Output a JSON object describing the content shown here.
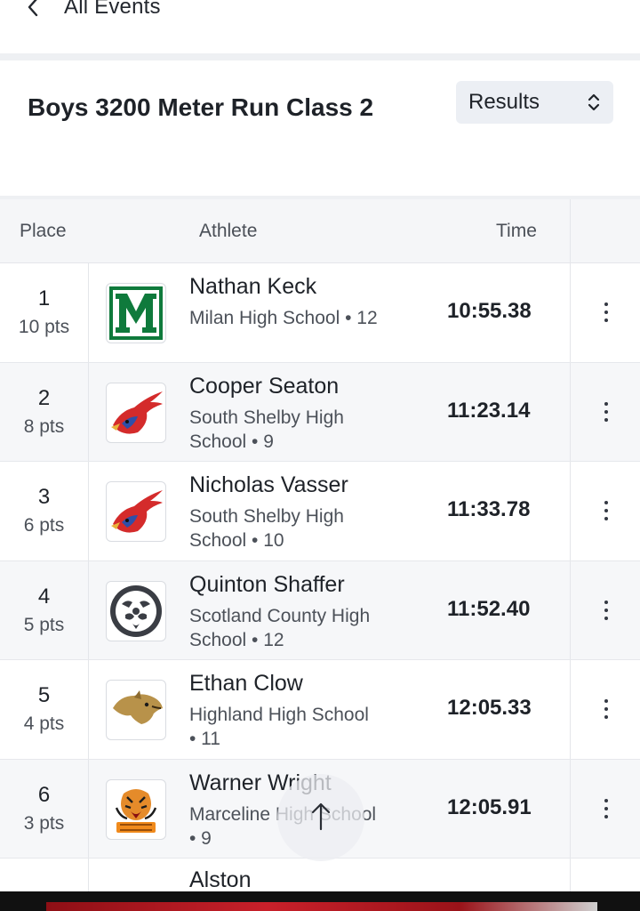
{
  "nav": {
    "back_label": "All Events"
  },
  "event": {
    "title": "Boys 3200 Meter Run Class 2"
  },
  "view_select": {
    "selected": "Results"
  },
  "table": {
    "headers": {
      "place": "Place",
      "athlete": "Athlete",
      "time": "Time"
    },
    "rows": [
      {
        "place": "1",
        "points": "10 pts",
        "name": "Nathan Keck",
        "school": "Milan High School • 12",
        "time": "10:55.38",
        "logo": "milan-m-logo"
      },
      {
        "place": "2",
        "points": "8 pts",
        "name": "Cooper Seaton",
        "school": "South Shelby High School • 9",
        "time": "11:23.14",
        "logo": "cardinal-logo"
      },
      {
        "place": "3",
        "points": "6 pts",
        "name": "Nicholas Vasser",
        "school": "South Shelby High School • 10",
        "time": "11:33.78",
        "logo": "cardinal-logo"
      },
      {
        "place": "4",
        "points": "5 pts",
        "name": "Quinton Shaffer",
        "school": "Scotland County High School • 12",
        "time": "11:52.40",
        "logo": "tiger-circle-logo"
      },
      {
        "place": "5",
        "points": "4 pts",
        "name": "Ethan Clow",
        "school": "Highland High School • 11",
        "time": "12:05.33",
        "logo": "cougar-logo"
      },
      {
        "place": "6",
        "points": "3 pts",
        "name": "Warner Wright",
        "school": "Marceline High School • 9",
        "time": "12:05.91",
        "logo": "tigers-logo"
      }
    ],
    "partial_row": {
      "name": "Alston"
    }
  },
  "colors": {
    "milan_green": "#0f7a3c",
    "cardinal_red": "#d42b2b",
    "cardinal_blue": "#2f4fa8"
  }
}
